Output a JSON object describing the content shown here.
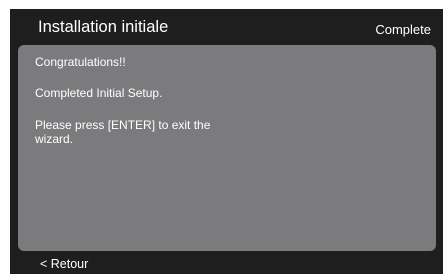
{
  "header": {
    "title": "Installation initiale",
    "step": "Complete"
  },
  "panel": {
    "line1": "Congratulations!!",
    "line2": "Completed Initial Setup.",
    "line3": "Please press [ENTER] to exit the wizard."
  },
  "footer": {
    "back_label": "< Retour"
  }
}
